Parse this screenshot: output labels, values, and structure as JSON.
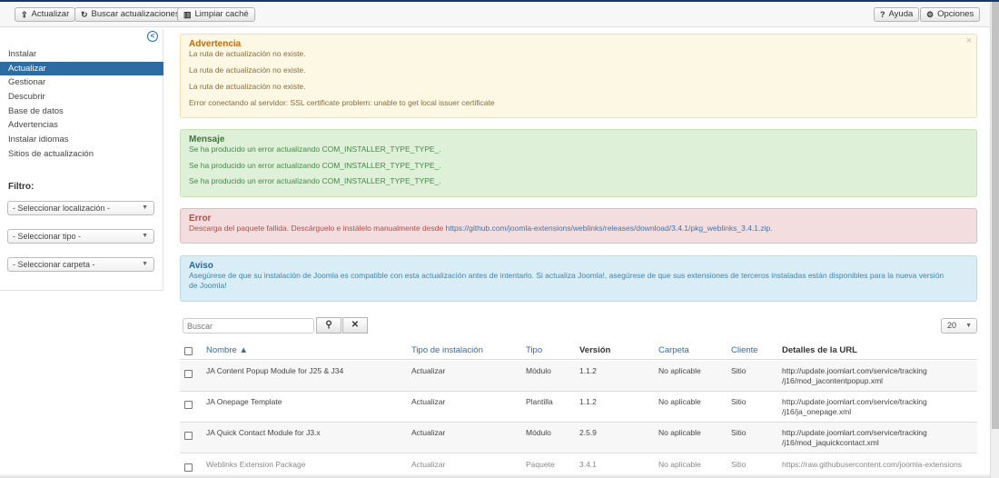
{
  "toolbar": {
    "actualizar": "Actualizar",
    "buscar": "Buscar actualizaciones",
    "limpiar": "Limpiar caché",
    "ayuda": "Ayuda",
    "opciones": "Opciones"
  },
  "sidebar": {
    "items": [
      {
        "label": "Instalar"
      },
      {
        "label": "Actualizar"
      },
      {
        "label": "Gestionar"
      },
      {
        "label": "Descubrir"
      },
      {
        "label": "Base de datos"
      },
      {
        "label": "Advertencias"
      },
      {
        "label": "Instalar idiomas"
      },
      {
        "label": "Sitios de actualización"
      }
    ],
    "filter_title": "Filtro:",
    "filters": {
      "location": "- Seleccionar localización -",
      "type": "- Seleccionar tipo -",
      "folder": "- Seleccionar carpeta -"
    }
  },
  "alerts": {
    "warning": {
      "heading": "Advertencia",
      "lines": [
        "La ruta de actualización no existe.",
        "La ruta de actualización no existe.",
        "La ruta de actualización no existe.",
        "Error conectando al servidor: SSL certificate problem: unable to get local issuer certificate"
      ]
    },
    "message": {
      "heading": "Mensaje",
      "lines": [
        "Se ha producido un error actualizando COM_INSTALLER_TYPE_TYPE_.",
        "Se ha producido un error actualizando COM_INSTALLER_TYPE_TYPE_.",
        "Se ha producido un error actualizando COM_INSTALLER_TYPE_TYPE_."
      ]
    },
    "error": {
      "heading": "Error",
      "text": "Descarga del paquete fallida. Descárguelo e instálelo manualmente desde ",
      "link": "https://github.com/joomla-extensions/weblinks/releases/download/3.4.1/pkg_weblinks_3.4.1.zip",
      "suffix": "."
    },
    "info": {
      "heading": "Aviso",
      "text": "Asegúrese de que su instalación de Joomla es compatible con esta actualización antes de intentarlo. Si actualiza Joomla!, asegúrese de que sus extensiones de terceros instaladas están disponibles para la nueva versión de Joomla!"
    }
  },
  "search": {
    "placeholder": "Buscar"
  },
  "list_limit": "20",
  "table": {
    "headers": {
      "name": "Nombre",
      "install_type": "Tipo de instalación",
      "type": "Tipo",
      "version": "Versión",
      "folder": "Carpeta",
      "client": "Cliente",
      "url": "Detalles de la URL"
    },
    "rows": [
      {
        "name": "JA Content Popup Module for J25 & J34",
        "install_type": "Actualizar",
        "type": "Módulo",
        "version": "1.1.2",
        "folder": "No aplicable",
        "client": "Sitio",
        "url1": "http://update.joomlart.com/service/tracking",
        "url2": "/j16/mod_jacontentpopup.xml"
      },
      {
        "name": "JA Onepage Template",
        "install_type": "Actualizar",
        "type": "Plantilla",
        "version": "1.1.2",
        "folder": "No aplicable",
        "client": "Sitio",
        "url1": "http://update.joomlart.com/service/tracking",
        "url2": "/j16/ja_onepage.xml"
      },
      {
        "name": "JA Quick Contact Module for J3.x",
        "install_type": "Actualizar",
        "type": "Módulo",
        "version": "2.5.9",
        "folder": "No aplicable",
        "client": "Sitio",
        "url1": "http://update.joomlart.com/service/tracking",
        "url2": "/j16/mod_jaquickcontact.xml"
      },
      {
        "name": "Weblinks Extension Package",
        "install_type": "Actualizar",
        "type": "Paquete",
        "version": "3.4.1",
        "folder": "No aplicable",
        "client": "Sitio",
        "url1": "https://raw.githubusercontent.com/joomla-extensions",
        "url2": ""
      }
    ]
  }
}
